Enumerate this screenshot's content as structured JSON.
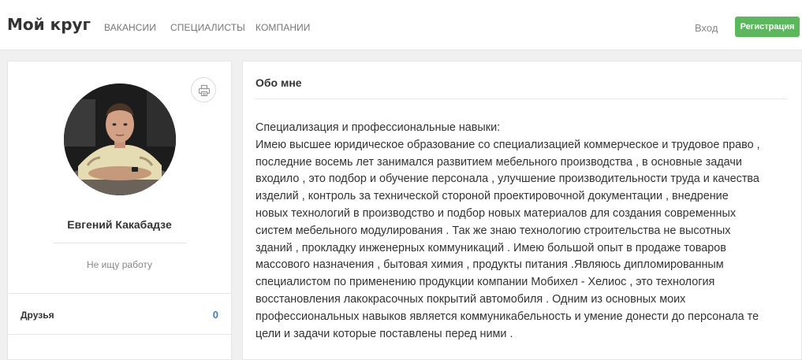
{
  "header": {
    "logo": "Мой круг",
    "nav": {
      "vacancies": "ВАКАНСИИ",
      "specialists": "СПЕЦИАЛИСТЫ",
      "companies": "КОМПАНИИ"
    },
    "login_label": "Вход",
    "register_label": "Регистрация"
  },
  "profile": {
    "name": "Евгений Какабадзе",
    "status": "Не ищу работу",
    "friends_label": "Друзья",
    "friends_count": "0"
  },
  "about": {
    "title": "Обо мне",
    "lines": [
      "Специализация и профессиональные навыки:",
      "Имею высшее юридическое образование со специализацией коммерческое и трудовое право ,",
      "последние восемь лет занимался развитием мебельного производства , в основные задачи",
      "входило , это подбор и обучение персонала , улучшение производительности труда и качества",
      "изделий , контроль за технической стороной проектировочной документации , внедрение",
      "новых технологий в производство и подбор новых материалов для создания современных",
      "систем мебельного модулирования . Так же знаю технологию строительства не высотных",
      "зданий , прокладку инженерных коммуникаций . Имею большой опыт в продаже товаров",
      "массового назначения , бытовая химия , продукты питания .Являюсь дипломированным",
      "специалистом по применению продукции компании Мобихел - Хелиос , это технология",
      "восстановления лакокрасочных покрытий автомобиля . Одним из основных моих",
      "профессиональных навыков является коммуникабельность и умение донести до персонала те",
      "цели и задачи которые поставлены перед ними ."
    ]
  },
  "icons": {
    "print": "printer-icon"
  },
  "colors": {
    "register_bg": "#5cb85c",
    "friends_count": "#3d7ebb",
    "page_bg": "#f0f0f0"
  }
}
